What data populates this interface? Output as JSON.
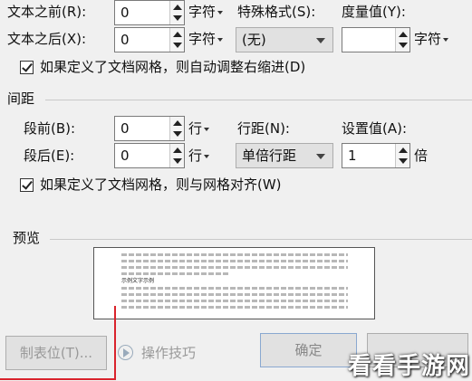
{
  "indent": {
    "before_label": "文本之前(R):",
    "before_value": "0",
    "after_label": "文本之后(X):",
    "after_value": "0",
    "unit": "字符",
    "special_label": "特殊格式(S):",
    "special_value": "(无)",
    "measure_label": "度量值(Y):",
    "measure_value": "",
    "measure_unit": "字符",
    "auto_adjust_label": "如果定义了文档网格，则自动调整右缩进(D)",
    "auto_adjust_checked": true
  },
  "spacing": {
    "section_title": "间距",
    "before_label": "段前(B):",
    "before_value": "0",
    "after_label": "段后(E):",
    "after_value": "0",
    "unit": "行",
    "line_spacing_label": "行距(N):",
    "line_spacing_value": "单倍行距",
    "set_value_label": "设置值(A):",
    "set_value": "1",
    "set_value_unit": "倍",
    "snap_grid_label": "如果定义了文档网格，则与网格对齐(W)",
    "snap_grid_checked": true
  },
  "preview": {
    "section_title": "预览",
    "sample_text": "示例文字示例"
  },
  "footer": {
    "tabs_button": "制表位(T)...",
    "tips_button": "操作技巧",
    "ok_button": "确定"
  },
  "watermark": "看看手游网",
  "colors": {
    "dialog_bg": "#f0f0f0",
    "highlight_box": "#d9232c"
  }
}
